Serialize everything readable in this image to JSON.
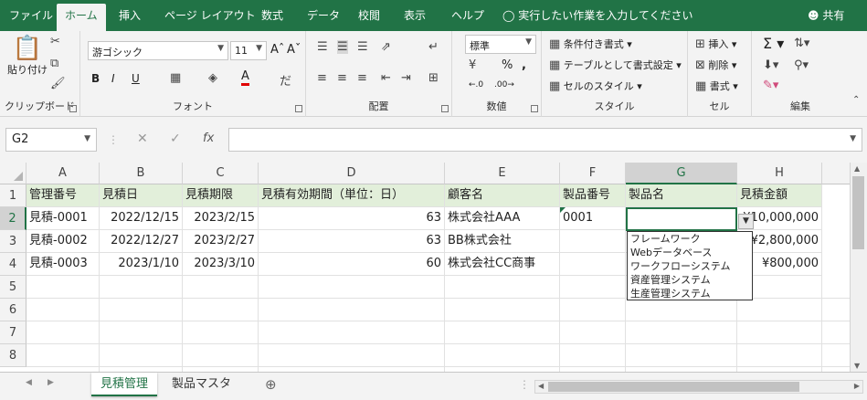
{
  "tabs": [
    "ファイル",
    "ホーム",
    "挿入",
    "ページ レイアウト",
    "数式",
    "データ",
    "校閲",
    "表示",
    "ヘルプ"
  ],
  "active_tab": "ホーム",
  "tell_me": "実行したい作業を入力してください",
  "share": "共有",
  "ribbon": {
    "clipboard": {
      "label": "クリップボード",
      "paste": "貼り付け"
    },
    "font": {
      "label": "フォント",
      "font_name": "游ゴシック",
      "font_size": "11",
      "bold": "B",
      "italic": "I",
      "underline": "U"
    },
    "alignment": {
      "label": "配置"
    },
    "number": {
      "label": "数値",
      "format": "標準"
    },
    "styles": {
      "label": "スタイル",
      "conditional": "条件付き書式",
      "table": "テーブルとして書式設定",
      "cell_styles": "セルのスタイル"
    },
    "cells": {
      "label": "セル",
      "insert": "挿入",
      "delete": "削除",
      "format": "書式"
    },
    "editing": {
      "label": "編集"
    }
  },
  "formula_bar": {
    "name_box": "G2",
    "fx": "fx",
    "formula": ""
  },
  "columns": [
    "A",
    "B",
    "C",
    "D",
    "E",
    "F",
    "G",
    "H"
  ],
  "rows": [
    "1",
    "2",
    "3",
    "4",
    "5",
    "6",
    "7",
    "8"
  ],
  "header_row": [
    "管理番号",
    "見積日",
    "見積期限",
    "見積有効期間（単位：日）",
    "顧客名",
    "製品番号",
    "製品名",
    "見積金額"
  ],
  "data_rows": [
    [
      "見積-0001",
      "2022/12/15",
      "2023/2/15",
      "63",
      "株式会社AAA",
      "0001",
      "",
      "¥10,000,000"
    ],
    [
      "見積-0002",
      "2022/12/27",
      "2023/2/27",
      "63",
      "BB株式会社",
      "",
      "",
      "¥2,800,000"
    ],
    [
      "見積-0003",
      "2023/1/10",
      "2023/3/10",
      "60",
      "株式会社CC商事",
      "",
      "",
      "¥800,000"
    ]
  ],
  "dropdown_options": [
    "フレームワーク",
    "Webデータベース",
    "ワークフローシステム",
    "資産管理システム",
    "生産管理システム"
  ],
  "sheets": [
    "見積管理",
    "製品マスタ"
  ],
  "active_sheet": "見積管理",
  "colors": {
    "excel_green": "#217346",
    "header_fill": "#e2efda"
  }
}
